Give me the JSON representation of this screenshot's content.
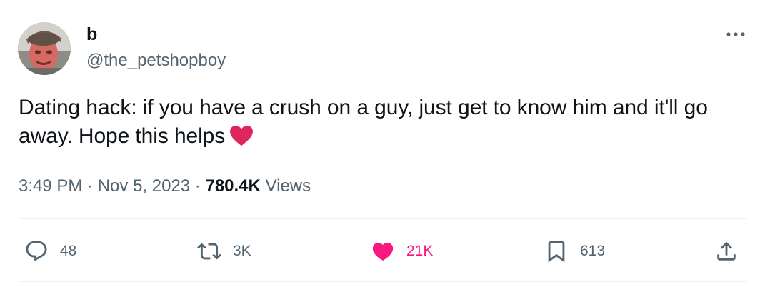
{
  "author": {
    "display_name": "b",
    "handle": "@the_petshopboy"
  },
  "tweet": {
    "text": "Dating hack: if you have a crush on a guy, just get to know him and it'll go away. Hope this helps",
    "emoji": "red-heart"
  },
  "meta": {
    "time": "3:49 PM",
    "separator": " · ",
    "date": "Nov 5, 2023",
    "views_count": "780.4K",
    "views_label": "Views"
  },
  "actions": {
    "replies": "48",
    "reposts": "3K",
    "likes": "21K",
    "bookmarks": "613"
  },
  "icons": {
    "more": "more-dots-icon",
    "reply": "reply-bubble-icon",
    "repost": "repost-arrows-icon",
    "like": "heart-filled-icon",
    "bookmark": "bookmark-icon",
    "share": "share-upload-icon"
  },
  "colors": {
    "text_primary": "#0f1419",
    "text_secondary": "#536471",
    "like_active": "#f91880",
    "divider": "#eff3f4",
    "emoji_heart": "#e0245e"
  }
}
